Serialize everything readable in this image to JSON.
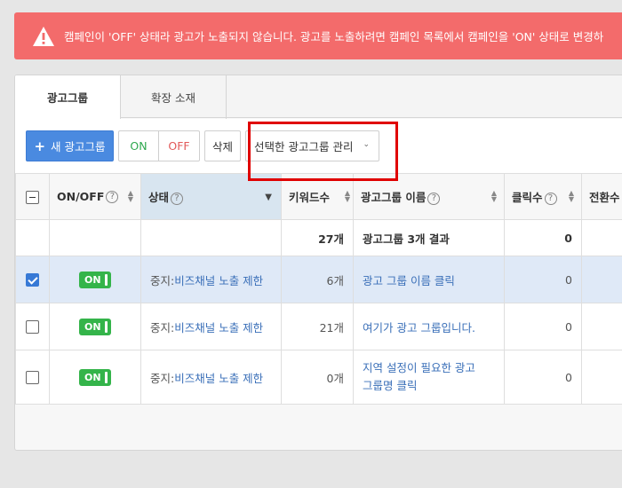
{
  "alert": {
    "text": "캠페인이 'OFF' 상태라 광고가 노출되지 않습니다. 광고를 노출하려면 캠페인 목록에서 캠페인을 'ON' 상태로 변경하",
    "color": "#f36b6b"
  },
  "tabs": [
    {
      "label": "광고그룹"
    },
    {
      "label": "확장 소재"
    }
  ],
  "toolbar": {
    "new_label": "새 광고그룹",
    "on_label": "ON",
    "off_label": "OFF",
    "delete_label": "삭제",
    "manage_label": "선택한 광고그룹 관리"
  },
  "table": {
    "headers": {
      "onoff": "ON/OFF",
      "status": "상태",
      "keywords": "키워드수",
      "name": "광고그룹 이름",
      "clicks": "클릭수",
      "conversions": "전환수"
    },
    "summary": {
      "keywords": "27개",
      "name": "광고그룹 3개 결과",
      "clicks": "0"
    },
    "rows": [
      {
        "checked": true,
        "toggle": "ON",
        "status_prefix": "중지:",
        "status_link": "비즈채널 노출 제한",
        "keywords": "6개",
        "name": "광고 그룹 이름 클릭",
        "clicks": "0"
      },
      {
        "checked": false,
        "toggle": "ON",
        "status_prefix": "중지:",
        "status_link": "비즈채널 노출 제한",
        "keywords": "21개",
        "name": "여기가 광고 그룹입니다.",
        "clicks": "0"
      },
      {
        "checked": false,
        "toggle": "ON",
        "status_prefix": "중지:",
        "status_link": "비즈채널 노출 제한",
        "keywords": "0개",
        "name_line1": "지역 설정이 필요한 광고",
        "name_line2": "그룹명 클릭",
        "clicks": "0"
      }
    ]
  },
  "colors": {
    "primary": "#4a8ae0",
    "on_green": "#34b44a",
    "off_red": "#e25a5a",
    "highlight": "#e00000",
    "link": "#3a6fb8"
  }
}
